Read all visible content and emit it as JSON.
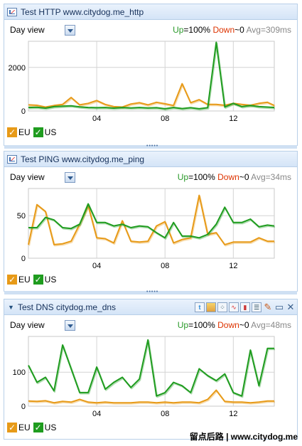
{
  "panels": [
    {
      "title": "Test HTTP www.citydog.me_http",
      "view_label": "Day view",
      "up_label": "Up",
      "up_value": "=100%",
      "down_label": "Down",
      "down_value": "~0",
      "avg_label": "Avg",
      "avg_value": "=309ms",
      "legend": [
        "EU",
        "US"
      ],
      "toolbar": false
    },
    {
      "title": "Test PING www.citydog.me_ping",
      "view_label": "Day view",
      "up_label": "Up",
      "up_value": "=100%",
      "down_label": "Down",
      "down_value": "~0",
      "avg_label": "Avg",
      "avg_value": "=34ms",
      "legend": [
        "EU",
        "US"
      ],
      "toolbar": false
    },
    {
      "title": "Test DNS citydog.me_dns",
      "view_label": "Day view",
      "up_label": "Up",
      "up_value": "=100%",
      "down_label": "Down",
      "down_value": "~0",
      "avg_label": "Avg",
      "avg_value": "=48ms",
      "legend": [
        "EU",
        "US"
      ],
      "toolbar": true,
      "toolbar_icons": [
        "twitter-icon",
        "image-icon",
        "scatter-icon",
        "line-chart-icon",
        "bar-chart-icon",
        "table-icon",
        "edit-icon",
        "maximize-icon",
        "close-icon"
      ]
    }
  ],
  "footer": "留点后路 | www.citydog.me",
  "colors": {
    "eu": "#e79a18",
    "us": "#1f9c1f",
    "grid": "#d4d4d4",
    "up": "#2b9a2b",
    "down": "#dd3300",
    "avg": "#888888"
  },
  "chart_data": [
    {
      "type": "line",
      "title": "Test HTTP www.citydog.me_http",
      "xlabel": "",
      "ylabel": "",
      "xlim": [
        0,
        14.4
      ],
      "x_ticks": [
        4,
        8,
        12
      ],
      "x_tick_labels": [
        "04",
        "08",
        "12"
      ],
      "ylim": [
        0,
        3200
      ],
      "y_ticks": [
        0,
        2000
      ],
      "grid": true,
      "legend": "bottom-left",
      "x": [
        0,
        0.5,
        1,
        1.5,
        2,
        2.5,
        3,
        3.5,
        4,
        4.5,
        5,
        5.5,
        6,
        6.5,
        7,
        7.5,
        8,
        8.5,
        9,
        9.5,
        10,
        10.5,
        11,
        11.5,
        12,
        12.5,
        13,
        13.5,
        14,
        14.4
      ],
      "series": [
        {
          "name": "EU",
          "color": "#e79a18",
          "values": [
            280,
            260,
            180,
            250,
            300,
            620,
            280,
            350,
            480,
            300,
            200,
            180,
            320,
            380,
            280,
            400,
            330,
            250,
            1250,
            380,
            520,
            300,
            300,
            260,
            350,
            300,
            260,
            350,
            400,
            250
          ]
        },
        {
          "name": "US",
          "color": "#1f9c1f",
          "values": [
            160,
            170,
            130,
            200,
            220,
            240,
            190,
            160,
            150,
            160,
            130,
            160,
            140,
            160,
            140,
            150,
            100,
            160,
            110,
            150,
            100,
            150,
            3150,
            180,
            350,
            200,
            250,
            200,
            180,
            160
          ]
        }
      ]
    },
    {
      "type": "line",
      "title": "Test PING www.citydog.me_ping",
      "xlabel": "",
      "ylabel": "",
      "xlim": [
        0,
        14.4
      ],
      "x_ticks": [
        4,
        8,
        12
      ],
      "x_tick_labels": [
        "04",
        "08",
        "12"
      ],
      "ylim": [
        0,
        82
      ],
      "y_ticks": [
        0,
        50
      ],
      "grid": true,
      "legend": "bottom-left",
      "x": [
        0,
        0.5,
        1,
        1.5,
        2,
        2.5,
        3,
        3.5,
        4,
        4.5,
        5,
        5.5,
        6,
        6.5,
        7,
        7.5,
        8,
        8.5,
        9,
        9.5,
        10,
        10.5,
        11,
        11.5,
        12,
        12.5,
        13,
        13.5,
        14,
        14.4
      ],
      "series": [
        {
          "name": "EU",
          "color": "#e79a18",
          "values": [
            16,
            63,
            55,
            16,
            17,
            20,
            40,
            62,
            24,
            23,
            18,
            44,
            20,
            19,
            20,
            38,
            43,
            18,
            22,
            24,
            74,
            28,
            30,
            16,
            19,
            19,
            19,
            24,
            20,
            20
          ]
        },
        {
          "name": "US",
          "color": "#1f9c1f",
          "values": [
            36,
            36,
            48,
            45,
            36,
            35,
            40,
            64,
            42,
            42,
            38,
            40,
            36,
            38,
            37,
            30,
            24,
            42,
            26,
            26,
            24,
            28,
            40,
            60,
            42,
            42,
            46,
            37,
            39,
            38
          ]
        }
      ]
    },
    {
      "type": "line",
      "title": "Test DNS citydog.me_dns",
      "xlabel": "",
      "ylabel": "",
      "xlim": [
        0,
        14.4
      ],
      "x_ticks": [
        4,
        8,
        12
      ],
      "x_tick_labels": [
        "04",
        "08",
        "12"
      ],
      "ylim": [
        0,
        205
      ],
      "y_ticks": [
        0,
        100
      ],
      "grid": true,
      "legend": "bottom-left",
      "x": [
        0,
        0.5,
        1,
        1.5,
        2,
        2.5,
        3,
        3.5,
        4,
        4.5,
        5,
        5.5,
        6,
        6.5,
        7,
        7.5,
        8,
        8.5,
        9,
        9.5,
        10,
        10.5,
        11,
        11.5,
        12,
        12.5,
        13,
        13.5,
        14,
        14.4
      ],
      "series": [
        {
          "name": "EU",
          "color": "#e79a18",
          "values": [
            15,
            14,
            16,
            10,
            14,
            12,
            20,
            12,
            10,
            12,
            10,
            10,
            10,
            12,
            12,
            10,
            12,
            10,
            12,
            12,
            10,
            20,
            47,
            14,
            12,
            12,
            10,
            12,
            15,
            15
          ]
        },
        {
          "name": "US",
          "color": "#1f9c1f",
          "values": [
            120,
            70,
            85,
            45,
            180,
            110,
            40,
            40,
            115,
            50,
            70,
            85,
            55,
            80,
            195,
            30,
            40,
            70,
            60,
            40,
            110,
            90,
            75,
            95,
            40,
            30,
            165,
            60,
            170,
            170
          ]
        }
      ]
    }
  ]
}
